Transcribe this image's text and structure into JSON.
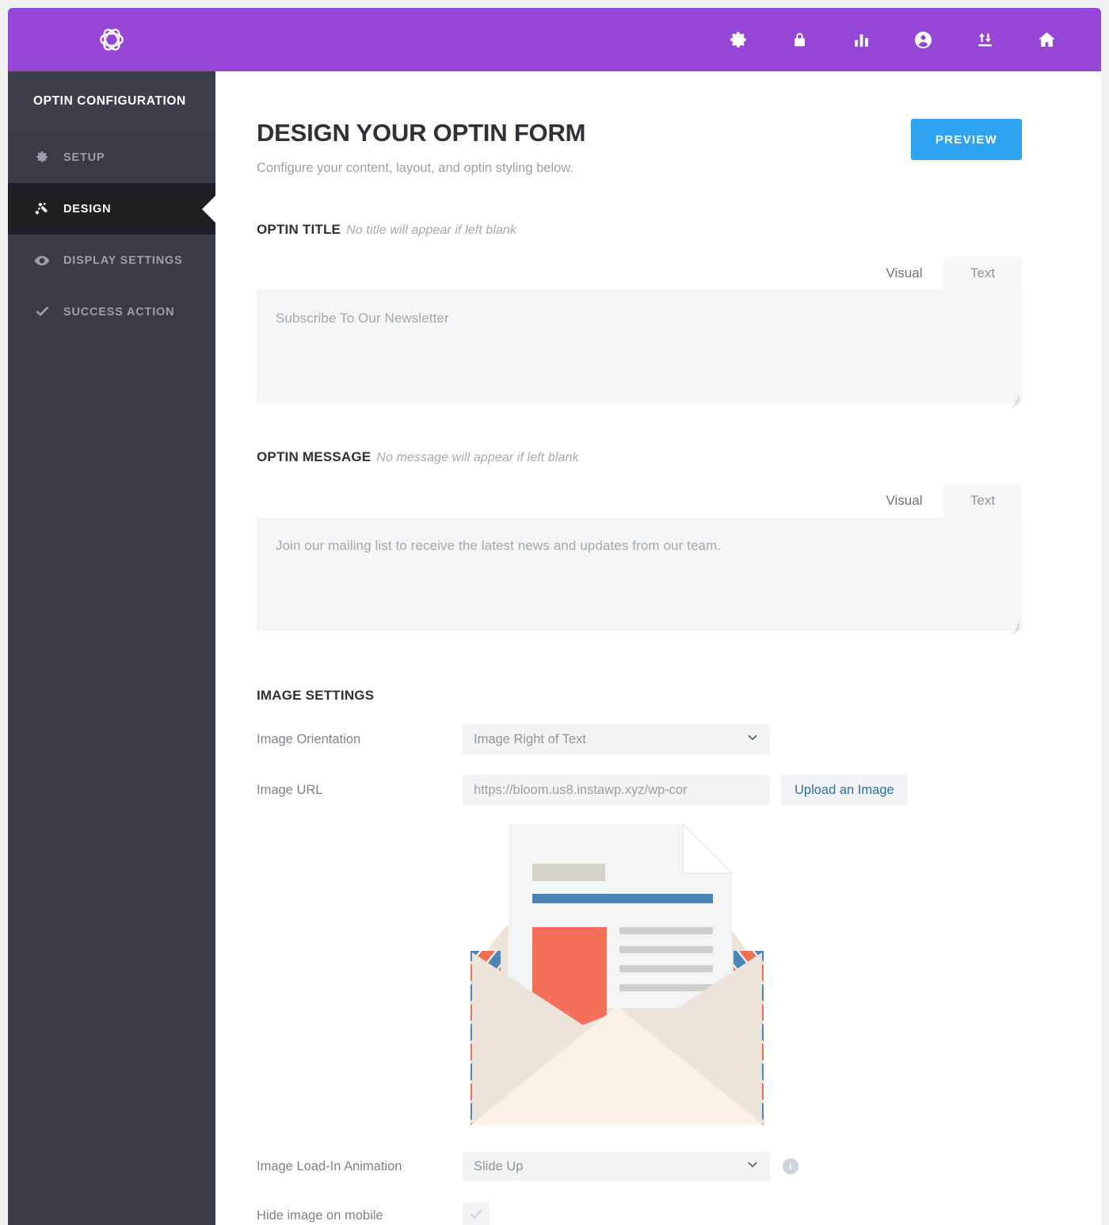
{
  "brand": {
    "logo_icon": "bloom-flower-logo"
  },
  "topnav": {
    "items": [
      {
        "name": "settings",
        "icon": "gear-icon"
      },
      {
        "name": "accounts",
        "icon": "lock-icon"
      },
      {
        "name": "statistics",
        "icon": "bar-chart-icon"
      },
      {
        "name": "optins",
        "icon": "user-circle-icon"
      },
      {
        "name": "import-export",
        "icon": "import-export-icon"
      },
      {
        "name": "home",
        "icon": "home-icon"
      }
    ]
  },
  "sidebar": {
    "title": "OPTIN CONFIGURATION",
    "items": [
      {
        "label": "SETUP",
        "icon": "gear-icon",
        "active": false
      },
      {
        "label": "DESIGN",
        "icon": "wand-sparkle-icon",
        "active": true
      },
      {
        "label": "DISPLAY SETTINGS",
        "icon": "eye-icon",
        "active": false
      },
      {
        "label": "SUCCESS ACTION",
        "icon": "check-icon",
        "active": false
      }
    ]
  },
  "page": {
    "title": "DESIGN YOUR OPTIN FORM",
    "subtitle": "Configure your content, layout, and optin styling below.",
    "preview_label": "PREVIEW"
  },
  "optin_title": {
    "label": "OPTIN TITLE",
    "hint": "No title will appear if left blank",
    "tabs": [
      {
        "label": "Visual",
        "active": true
      },
      {
        "label": "Text",
        "active": false
      }
    ],
    "value": "Subscribe To Our Newsletter"
  },
  "optin_message": {
    "label": "OPTIN MESSAGE",
    "hint": "No message will appear if left blank",
    "tabs": [
      {
        "label": "Visual",
        "active": true
      },
      {
        "label": "Text",
        "active": false
      }
    ],
    "value": "Join our mailing list to receive the latest news and updates from our team."
  },
  "image_settings": {
    "heading": "IMAGE SETTINGS",
    "orientation": {
      "label": "Image Orientation",
      "value": "Image Right of Text"
    },
    "url": {
      "label": "Image URL",
      "value": "https://bloom.us8.instawp.xyz/wp-cor",
      "upload_label": "Upload an Image"
    },
    "preview_icon": "open-envelope-newsletter-image",
    "animation": {
      "label": "Image Load-In Animation",
      "value": "Slide Up",
      "info_icon": "info-icon"
    },
    "hide_mobile": {
      "label": "Hide image on mobile",
      "checked": true
    }
  },
  "colors": {
    "brand_purple": "#9546d6",
    "sidebar_dark": "#383c45",
    "sidebar_active": "#1e2026",
    "accent_blue": "#2ea3f2",
    "field_bg": "#f1f3f6",
    "page_bg": "#f1f1f1"
  }
}
